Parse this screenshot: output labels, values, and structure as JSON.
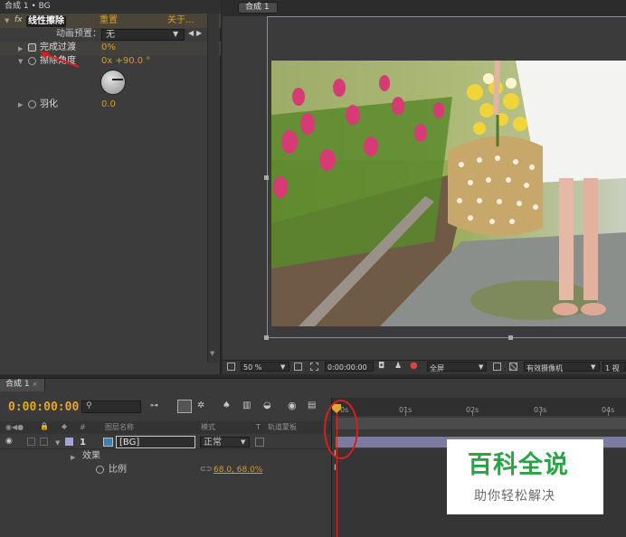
{
  "effect_controls": {
    "title": "合成 1 • BG",
    "effect_name": "线性擦除",
    "reset_label": "重置",
    "about_label": "关于...",
    "preset_label": "动画预置：",
    "preset_value": "无",
    "properties": [
      {
        "name": "完成过渡",
        "value": "0%"
      },
      {
        "name": "擦除角度",
        "value": "0x +90.0 °"
      },
      {
        "name": "羽化",
        "value": "0.0"
      }
    ]
  },
  "composition": {
    "tab_label": "合成 1",
    "toolbar": {
      "zoom": "50 %",
      "timecode": "0:00:00:00",
      "resolution": "全屏",
      "camera": "有效摄像机",
      "views": "1",
      "views_label": "1 视"
    }
  },
  "timeline": {
    "tab_label": "合成 1",
    "timecode": "0:00:00:00",
    "columns": {
      "source_name": "图层名称",
      "mode": "模式",
      "t": "T",
      "track_matte": "轨道蒙板",
      "num": "#"
    },
    "ruler_labels": [
      "0s",
      "01s",
      "02s",
      "03s",
      "04s"
    ],
    "layer": {
      "index": "1",
      "name": "[BG]",
      "mode": "正常"
    },
    "effects_label": "效果",
    "scale": {
      "name": "比例",
      "value": "68.0, 68.0%"
    }
  },
  "watermark": {
    "main": "百科全说",
    "sub": "助你轻松解决"
  },
  "colors": {
    "accent_orange": "#d89a2e",
    "timecode": "#e3a72a",
    "layer_bar": "#7b7ba0",
    "annotation_red": "#d81f1f",
    "watermark_green": "#27a547"
  }
}
